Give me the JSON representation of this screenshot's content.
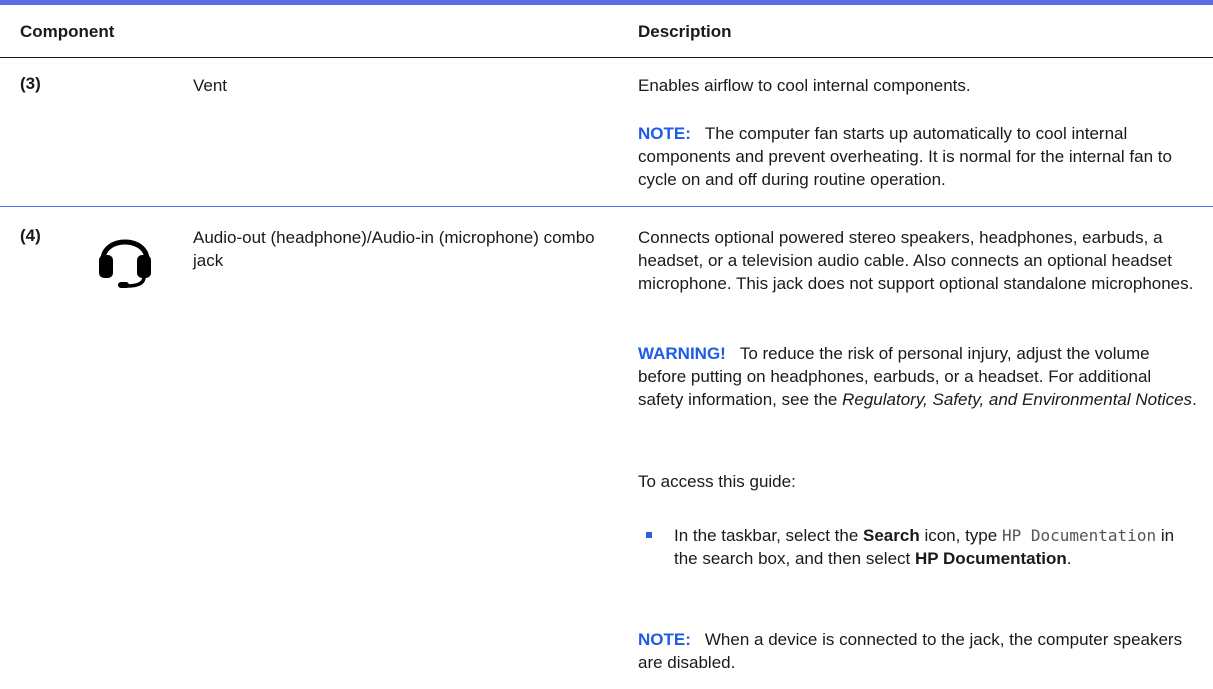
{
  "header": {
    "component": "Component",
    "description": "Description"
  },
  "rows": [
    {
      "number": "(3)",
      "component": "Vent",
      "description": "Enables airflow to cool internal components.",
      "note_label": "NOTE:",
      "note_text": "The computer fan starts up automatically to cool internal components and prevent overheating. It is normal for the internal fan to cycle on and off during routine operation."
    },
    {
      "number": "(4)",
      "icon": "headset-icon",
      "component": "Audio-out (headphone)/Audio-in (microphone) combo jack",
      "description": "Connects optional powered stereo speakers, headphones, earbuds, a headset, or a television audio cable. Also connects an optional headset microphone. This jack does not support optional standalone microphones.",
      "warning_label": "WARNING!",
      "warning_text": "To reduce the risk of personal injury, adjust the volume before putting on headphones, earbuds, or a headset. For additional safety information, see the",
      "warning_italic": "Regulatory, Safety, and Environmental Notices",
      "warning_end": ".",
      "access_text": "To access this guide:",
      "bullet_part1": "In the taskbar, select the",
      "bullet_search": "Search",
      "bullet_part2": "icon, type",
      "bullet_code": "HP Documentation",
      "bullet_part3": "in the search box, and then select",
      "bullet_hp": "HP Documentation",
      "bullet_end": ".",
      "note_label": "NOTE:",
      "note_text": "When a device is connected to the jack, the computer speakers are disabled."
    }
  ],
  "colors": {
    "accent": "#1e5be6",
    "rule": "#5b6ee8"
  }
}
